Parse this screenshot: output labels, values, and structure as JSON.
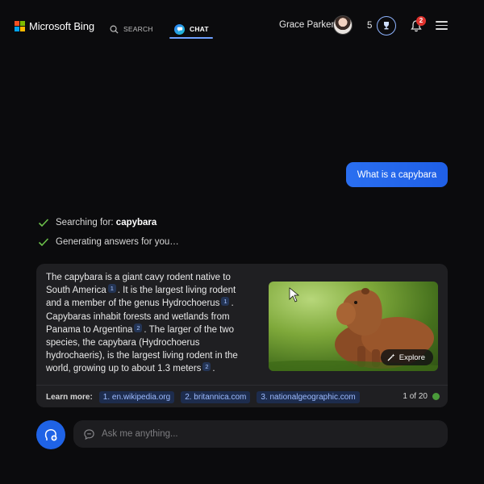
{
  "header": {
    "brand": "Microsoft Bing",
    "tabs": [
      {
        "label": "SEARCH",
        "icon": "search-icon",
        "active": false
      },
      {
        "label": "CHAT",
        "icon": "chat-icon",
        "active": true
      }
    ],
    "user_name": "Grace Parker",
    "reward_points": "5",
    "notification_count": "2",
    "colors": {
      "accent": "#6ea0ff",
      "user_bubble": "#2a6ff0",
      "notification": "#e0332e"
    }
  },
  "conversation": {
    "user_message": "What is a capybara",
    "status": [
      {
        "prefix": "Searching for: ",
        "bold": "capybara"
      },
      {
        "prefix": "Generating answers for you…",
        "bold": ""
      }
    ],
    "answer": {
      "parts": [
        {
          "text": "The capybara is a giant cavy rodent native to South America",
          "cite": "1"
        },
        {
          "text": ". It is the largest living rodent and a member of the genus Hydrochoerus",
          "cite": "1"
        },
        {
          "text": ". Capybaras inhabit forests and wetlands from Panama to Argentina",
          "cite": "2"
        },
        {
          "text": ". The larger of the two species, the capybara (Hydrochoerus hydrochaeris), is the largest living rodent in the world, growing up to about 1.3 meters",
          "cite": "2"
        },
        {
          "text": ".",
          "cite": ""
        }
      ],
      "image_alt": "capybara",
      "explore_label": "Explore"
    },
    "learn_more": {
      "label": "Learn more:",
      "sources": [
        "1. en.wikipedia.org",
        "2. britannica.com",
        "3. nationalgeographic.com"
      ],
      "pager": "1 of 20"
    }
  },
  "composer": {
    "placeholder": "Ask me anything..."
  }
}
